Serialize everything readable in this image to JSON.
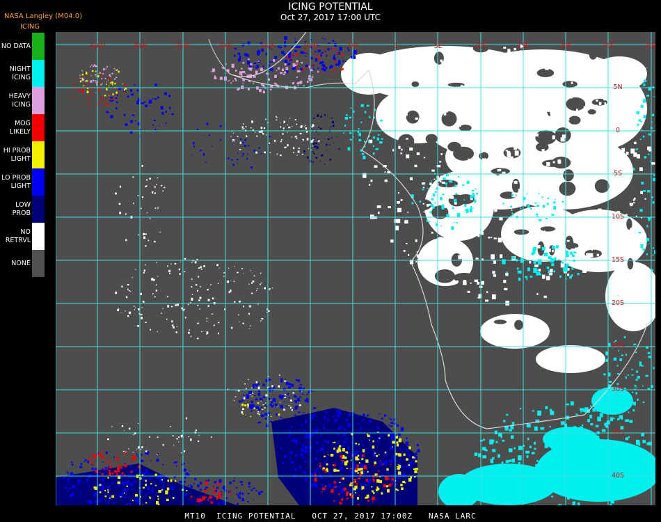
{
  "header": {
    "source": "NASA Langley (M04.0)",
    "product": "ICING",
    "title": "ICING POTENTIAL",
    "subtitle": "Oct 27, 2017 17:00 UTC"
  },
  "legend": [
    {
      "label": "NO DATA",
      "color": "#18b018"
    },
    {
      "label": "NIGHT\nICING",
      "color": "#00f0f0"
    },
    {
      "label": "HEAVY\nICING",
      "color": "#e0a0e0"
    },
    {
      "label": "MOG\nLIKELY",
      "color": "#f00000"
    },
    {
      "label": "HI PROB\nLIGHT",
      "color": "#f0f000"
    },
    {
      "label": "LO PROB\nLIGHT",
      "color": "#0000f0"
    },
    {
      "label": "LOW\nPROB",
      "color": "#000078"
    },
    {
      "label": "NO\nRETRVL",
      "color": "#ffffff"
    },
    {
      "label": "NONE",
      "color": "#505050"
    }
  ],
  "map": {
    "longitude_labels": [
      "40W",
      "30W",
      "25W",
      "20W",
      "15W",
      "10W",
      "5W",
      "0",
      "5E",
      "10E",
      "15E",
      "20E",
      "25E",
      "30E",
      "35E"
    ],
    "latitude_labels": [
      "5N",
      "0",
      "5S",
      "10S",
      "15S",
      "20S",
      "25S",
      "30S",
      "35S",
      "40S"
    ],
    "grid_color": "#40e0e0",
    "land_outline_color": "#d8d8d8"
  },
  "footer": "MT10  ICING POTENTIAL   OCT 27, 2017 17:00Z   NASA LARC"
}
